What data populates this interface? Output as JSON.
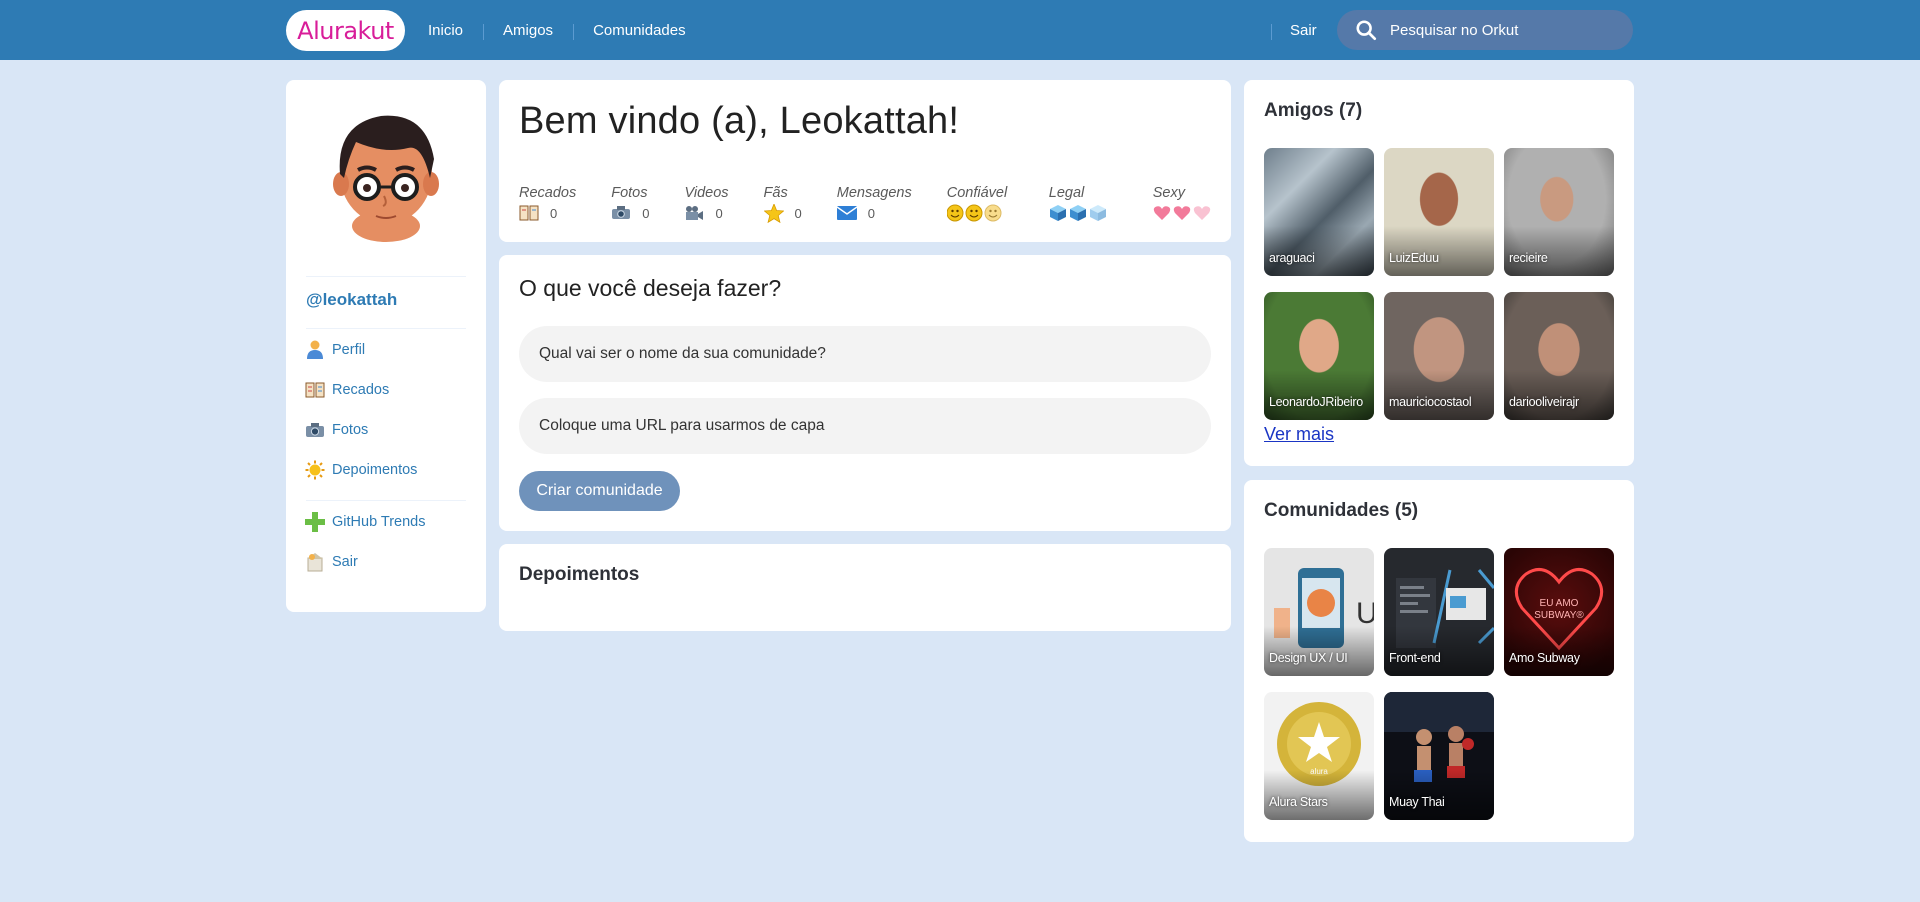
{
  "header": {
    "logo": "Alurakut",
    "nav": [
      "Inicio",
      "Amigos",
      "Comunidades"
    ],
    "logout": "Sair",
    "search_placeholder": "Pesquisar no Orkut"
  },
  "profile": {
    "username": "@leokattah",
    "menu": [
      {
        "label": "Perfil",
        "icon": "user-icon"
      },
      {
        "label": "Recados",
        "icon": "book-icon"
      },
      {
        "label": "Fotos",
        "icon": "camera-icon"
      },
      {
        "label": "Depoimentos",
        "icon": "sun-icon"
      }
    ],
    "menu2": [
      {
        "label": "GitHub Trends",
        "icon": "plus-icon"
      },
      {
        "label": "Sair",
        "icon": "logout-icon"
      }
    ]
  },
  "welcome": {
    "title": "Bem vindo (a), Leokattah!",
    "stats": [
      {
        "label": "Recados",
        "value": "0",
        "icon": "book-icon"
      },
      {
        "label": "Fotos",
        "value": "0",
        "icon": "camera-icon"
      },
      {
        "label": "Videos",
        "value": "0",
        "icon": "video-camera-icon"
      },
      {
        "label": "Fãs",
        "value": "0",
        "icon": "star-icon"
      },
      {
        "label": "Mensagens",
        "value": "0",
        "icon": "envelope-icon"
      },
      {
        "label": "Confiável",
        "icon": "smiley-icon"
      },
      {
        "label": "Legal",
        "icon": "cube-icon"
      },
      {
        "label": "Sexy",
        "icon": "heart-icon"
      }
    ]
  },
  "form": {
    "title": "O que você deseja fazer?",
    "name_placeholder": "Qual vai ser o nome da sua comunidade?",
    "image_placeholder": "Coloque uma URL para usarmos de capa",
    "submit": "Criar comunidade"
  },
  "testimonials": {
    "title": "Depoimentos"
  },
  "friends": {
    "title": "Amigos (7)",
    "more": "Ver mais",
    "items": [
      {
        "name": "araguaci"
      },
      {
        "name": "LuizEduu"
      },
      {
        "name": "recieire"
      },
      {
        "name": "LeonardoJRibeiro"
      },
      {
        "name": "mauriciocostaol"
      },
      {
        "name": "dariooliveirajr"
      }
    ]
  },
  "communities": {
    "title": "Comunidades (5)",
    "items": [
      {
        "name": "Design UX / UI"
      },
      {
        "name": "Front-end"
      },
      {
        "name": "Amo Subway"
      },
      {
        "name": "Alura Stars"
      },
      {
        "name": "Muay Thai"
      }
    ]
  },
  "colors": {
    "topbar": "#2E7BB4",
    "background": "#D9E6F6",
    "logo": "#D81D99",
    "link": "#2E7BB4",
    "button": "#6F92BB"
  }
}
